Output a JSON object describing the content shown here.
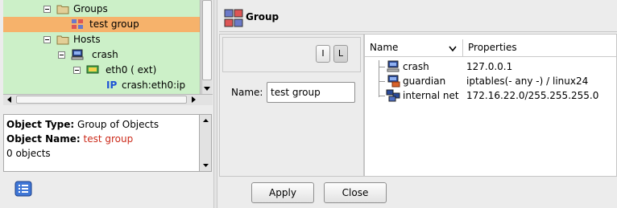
{
  "tree": {
    "items": [
      {
        "label": "Groups",
        "icon": "folder-icon"
      },
      {
        "label": "test group",
        "icon": "group-icon",
        "selected": true
      },
      {
        "label": "Hosts",
        "icon": "folder-icon"
      },
      {
        "label": "crash",
        "icon": "host-icon"
      },
      {
        "label": "eth0 ( ext)",
        "icon": "interface-icon"
      },
      {
        "label": "crash:eth0:ip",
        "icon": "ip-address-icon"
      }
    ]
  },
  "info": {
    "type_label": "Object Type:",
    "type_value": "Group of Objects",
    "name_label": "Object Name:",
    "name_value": "test group",
    "count": "0 objects"
  },
  "header": {
    "title": "Group"
  },
  "editor": {
    "btn_i": "I",
    "btn_l": "L",
    "name_label": "Name:",
    "name_value": "test group"
  },
  "list": {
    "col_name": "Name",
    "col_props": "Properties",
    "rows": [
      {
        "name": "crash",
        "props": "127.0.0.1",
        "icon": "host-icon"
      },
      {
        "name": "guardian",
        "props": "iptables(- any -) / linux24",
        "icon": "firewall-icon"
      },
      {
        "name": "internal net",
        "props": "172.16.22.0/255.255.255.0",
        "icon": "network-icon"
      }
    ]
  },
  "buttons": {
    "apply": "Apply",
    "close": "Close"
  },
  "colors": {
    "tree_bg": "#ccf0c8",
    "selection": "#f6b26b",
    "highlight_text": "#cc2a1a"
  }
}
